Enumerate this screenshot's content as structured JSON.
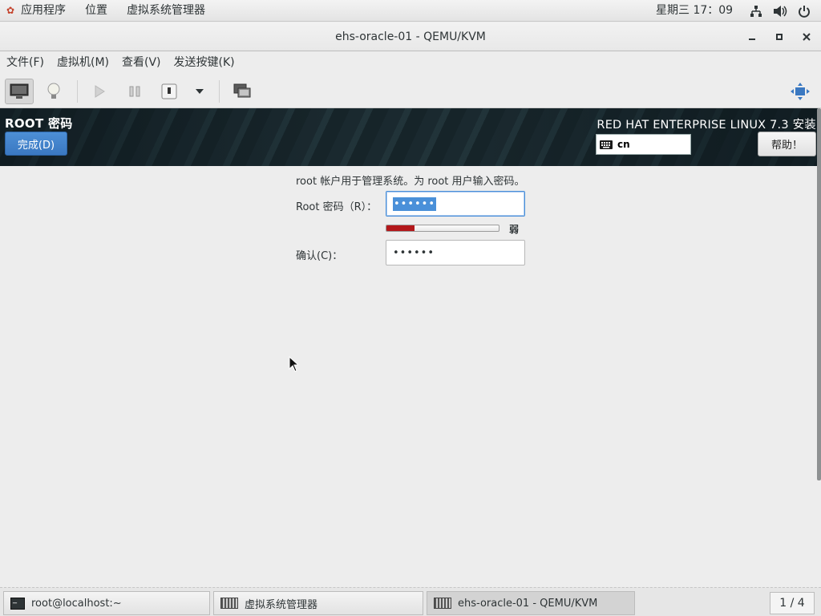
{
  "topbar": {
    "applications": "应用程序",
    "places": "位置",
    "app_menu": "虚拟系统管理器",
    "clock": "星期三 17：09",
    "tray_icons": [
      "network-icon",
      "volume-icon",
      "power-icon"
    ]
  },
  "window": {
    "title": "ehs-oracle-01 - QEMU/KVM"
  },
  "menubar": {
    "items": [
      "文件(F)",
      "虚拟机(M)",
      "查看(V)",
      "发送按键(K)"
    ]
  },
  "toolbar": {
    "buttons": [
      "console-icon",
      "details-bulb-icon",
      "run-icon",
      "pause-icon",
      "shutdown-icon",
      "shutdown-menu-icon",
      "snapshot-icon",
      "fullscreen-icon"
    ]
  },
  "anaconda": {
    "spoke_title": "ROOT 密码",
    "done_label": "完成(D)",
    "product": "RED HAT ENTERPRISE LINUX 7.3 安装",
    "keyboard_layout": "cn",
    "help_label": "帮助！"
  },
  "form": {
    "description": "root 帐户用于管理系统。为 root 用户输入密码。",
    "root_password_label": "Root 密码（R）：",
    "root_password_value": "••••••",
    "strength_fraction": 0.25,
    "strength_color": "#b3181b",
    "strength_label": "弱",
    "confirm_label": "确认(C)：",
    "confirm_value": "••••••"
  },
  "taskbar": {
    "tasks": [
      "root@localhost:~",
      "虚拟系统管理器",
      "ehs-oracle-01 - QEMU/KVM"
    ],
    "pager": "1 / 4"
  }
}
